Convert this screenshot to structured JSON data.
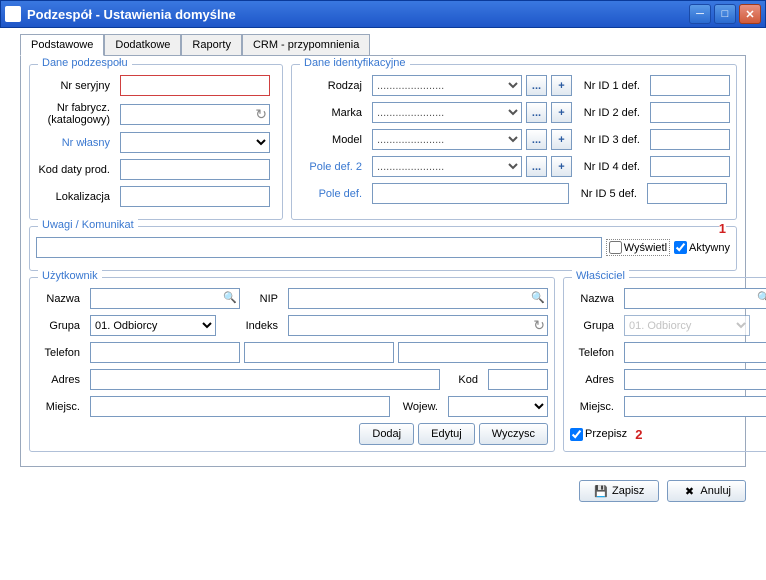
{
  "window": {
    "title": "Podzespół - Ustawienia domyślne"
  },
  "tabs": [
    "Podstawowe",
    "Dodatkowe",
    "Raporty",
    "CRM - przypomnienia"
  ],
  "sec": {
    "dane_podzespolu": "Dane podzespołu",
    "dane_ident": "Dane identyfikacyjne",
    "uwagi": "Uwagi / Komunikat",
    "uzytkownik": "Użytkownik",
    "wlasciciel": "Właściciel"
  },
  "lbl": {
    "nr_seryjny": "Nr seryjny",
    "nr_fabrycz": "Nr fabrycz. (katalogowy)",
    "nr_wlasny": "Nr własny",
    "kod_daty": "Kod daty prod.",
    "lokalizacja": "Lokalizacja",
    "rodzaj": "Rodzaj",
    "marka": "Marka",
    "model": "Model",
    "pole_def2": "Pole def. 2",
    "pole_def": "Pole def.",
    "nrid1": "Nr ID 1 def.",
    "nrid2": "Nr ID 2 def.",
    "nrid3": "Nr ID 3 def.",
    "nrid4": "Nr ID 4 def.",
    "nrid5": "Nr ID 5 def.",
    "wyswietl": "Wyświetl",
    "aktywny": "Aktywny",
    "nazwa": "Nazwa",
    "nip": "NIP",
    "grupa": "Grupa",
    "indeks": "Indeks",
    "telefon": "Telefon",
    "adres": "Adres",
    "kod": "Kod",
    "miejsc": "Miejsc.",
    "wojew": "Wojew.",
    "przepisz": "Przepisz"
  },
  "val": {
    "ident_placeholder": "......................",
    "grupa_user": "01. Odbiorcy",
    "grupa_owner": "01. Odbiorcy",
    "dots": "...",
    "plus": "+",
    "marker1": "1",
    "marker2": "2"
  },
  "btn": {
    "dodaj": "Dodaj",
    "edytuj": "Edytuj",
    "wyczysc": "Wyczysc",
    "zapisz": "Zapisz",
    "anuluj": "Anuluj"
  }
}
